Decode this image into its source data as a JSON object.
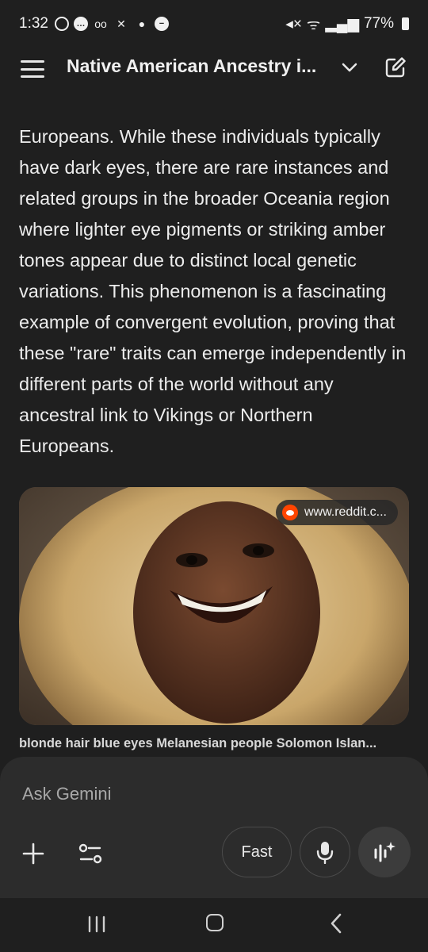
{
  "status_bar": {
    "time": "1:32",
    "battery": "77%"
  },
  "app_bar": {
    "title": "Native American Ancestry i...",
    "icons": [
      "menu-icon",
      "chevron-down-icon",
      "edit-icon"
    ]
  },
  "article": {
    "text": "Europeans. While these individuals typically have dark eyes, there are rare instances and related groups in the broader Oceania region where lighter eye pigments or striking amber tones appear due to distinct local genetic variations. This phenomenon is a fascinating example of convergent evolution, proving that these \"rare\" traits can emerge independently in different parts of the world without any ancestral link to Vikings or Northern Europeans."
  },
  "image_card": {
    "source": "www.reddit.c...",
    "caption": "blonde hair blue eyes Melanesian people Solomon Islan..."
  },
  "input_panel": {
    "placeholder": "Ask Gemini",
    "model_button": "Fast"
  },
  "colors": {
    "background": "#1f1f1f",
    "panel": "#2c2c2c",
    "reddit": "#ff4500"
  }
}
